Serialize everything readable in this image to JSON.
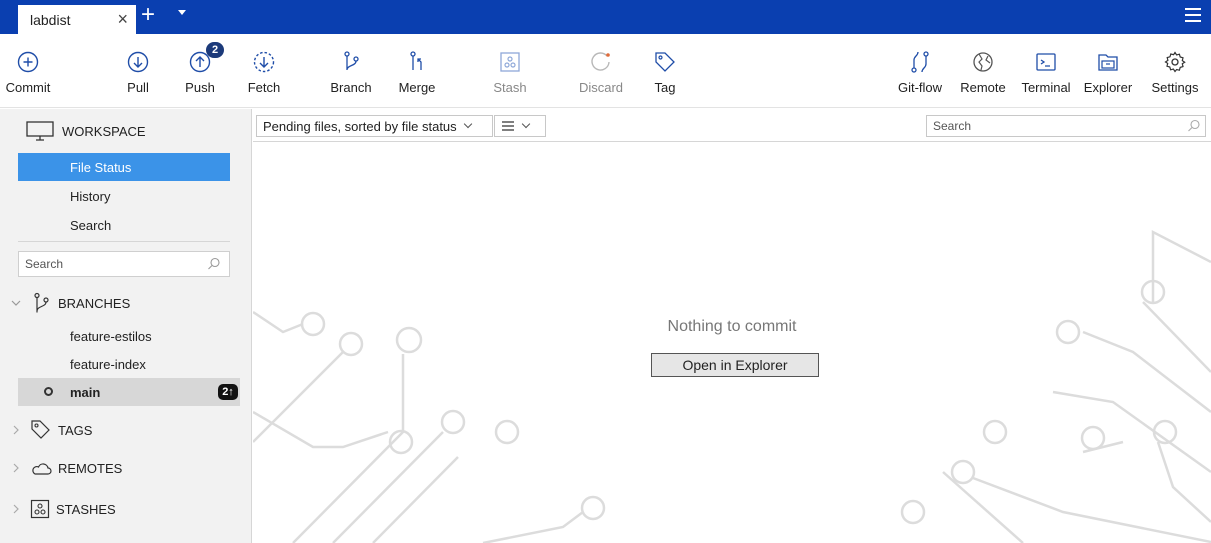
{
  "window": {
    "tab_label": "labdist"
  },
  "toolbar": {
    "commit": "Commit",
    "pull": "Pull",
    "push": "Push",
    "push_badge": "2",
    "fetch": "Fetch",
    "branch": "Branch",
    "merge": "Merge",
    "stash": "Stash",
    "discard": "Discard",
    "tag": "Tag",
    "gitflow": "Git-flow",
    "remote": "Remote",
    "terminal": "Terminal",
    "explorer": "Explorer",
    "settings": "Settings"
  },
  "sidebar": {
    "workspace": "WORKSPACE",
    "workspace_items": [
      "File Status",
      "History",
      "Search"
    ],
    "search_placeholder": "Search",
    "branches_header": "BRANCHES",
    "branches": [
      {
        "name": "feature-estilos"
      },
      {
        "name": "feature-index"
      },
      {
        "name": "main",
        "badge": "2↑"
      }
    ],
    "tags_header": "TAGS",
    "remotes_header": "REMOTES",
    "stashes_header": "STASHES"
  },
  "main": {
    "sort_label": "Pending files, sorted by file status",
    "search_placeholder": "Search",
    "empty_message": "Nothing to commit",
    "open_button": "Open in Explorer"
  },
  "colors": {
    "titlebar": "#0a3fb0",
    "selection": "#3b93e8",
    "toolbar_icon": "#1f4da8"
  }
}
